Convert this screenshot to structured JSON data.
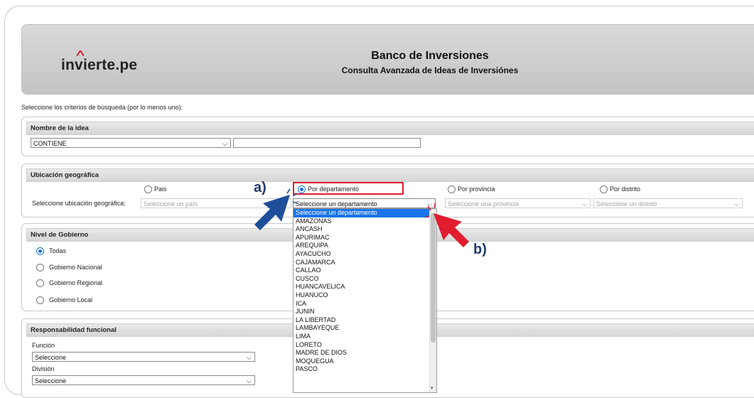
{
  "header": {
    "logo": "invierte.pe",
    "title": "Banco de Inversiones",
    "subtitle": "Consulta Avanzada de Ideas de Inversiónes"
  },
  "intro": "Seleccione los criterios de búsqueda (por lo menos uno):",
  "nombre": {
    "title": "Nombre de la idea",
    "match_value": "CONTIENE",
    "text_value": ""
  },
  "ubicacion": {
    "title": "Ubicación geográfica",
    "row_label": "Seleccione ubicación geográfica:",
    "options": [
      "Pais",
      "Por departamento",
      "Por provincia",
      "Por distrito"
    ],
    "selected": "Por departamento",
    "pais_placeholder": "Seleccione un país",
    "departamento_value": "Seleccione un departamento",
    "provincia_placeholder": "Seleccione una provincia",
    "distrito_placeholder": "Seleccione un distrito"
  },
  "dropdown_items": [
    "Seleccione un departamento",
    "AMAZONAS",
    "ANCASH",
    "APURIMAC",
    "AREQUIPA",
    "AYACUCHO",
    "CAJAMARCA",
    "CALLAO",
    "CUSCO",
    "HUANCAVELICA",
    "HUANUCO",
    "ICA",
    "JUNIN",
    "LA LIBERTAD",
    "LAMBAYEQUE",
    "LIMA",
    "LORETO",
    "MADRE DE DIOS",
    "MOQUEGUA",
    "PASCO"
  ],
  "nivel": {
    "title": "Nivel de Gobierno",
    "options": [
      "Todas",
      "Gobierno Nacional",
      "Gobierno Regional",
      "Gobierno Local"
    ],
    "selected": "Todas"
  },
  "responsabilidad": {
    "title": "Responsabilidad funcional",
    "funcion_label": "Función",
    "funcion_value": "Seleccione",
    "division_label": "División",
    "division_value": "Seleccione"
  },
  "annotations": {
    "a": "a)",
    "b": "b)"
  },
  "colors": {
    "accent": "#1a73e8",
    "arrow_blue": "#1f4e9a",
    "arrow_red": "#e11d2f",
    "highlight_box": "#e11d2f"
  }
}
